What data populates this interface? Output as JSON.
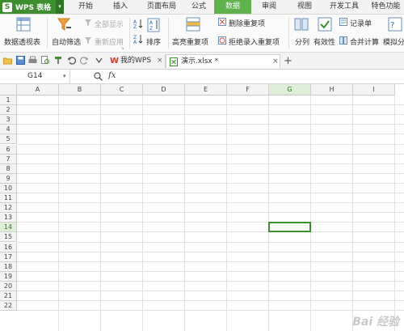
{
  "app": {
    "title": "WPS 表格",
    "logo": "S",
    "drop": "▾"
  },
  "menu": {
    "tabs": [
      "开始",
      "插入",
      "页面布局",
      "公式",
      "数据",
      "审阅",
      "视图",
      "开发工具",
      "特色功能"
    ],
    "active": "数据"
  },
  "ribbon": {
    "pivot": "数据透视表",
    "autofilter": "自动筛选",
    "showall": "全部显示",
    "reapply": "重新应用",
    "sort": "排序",
    "highlight_dup": "高亮重复项",
    "remove_dup": "删除重复项",
    "reject_dup": "拒绝录入重复项",
    "split": "分列",
    "validity": "有效性",
    "record": "记录单",
    "consolidate": "合并计算",
    "whatif": "模拟分"
  },
  "quick": {
    "docs": [
      {
        "label": "我的WPS"
      },
      {
        "label": "演示.xlsx *"
      }
    ],
    "add": "+"
  },
  "formula": {
    "cell_ref": "G14",
    "fx": "fx"
  },
  "grid": {
    "columns": [
      "A",
      "B",
      "C",
      "D",
      "E",
      "F",
      "G",
      "H",
      "I"
    ],
    "rows": [
      "1",
      "2",
      "3",
      "4",
      "5",
      "6",
      "7",
      "8",
      "9",
      "10",
      "11",
      "12",
      "13",
      "14",
      "15",
      "16",
      "17",
      "18",
      "19",
      "20",
      "21",
      "22"
    ],
    "active": {
      "col": "G",
      "row": "14"
    }
  },
  "watermark": "Bai 经验"
}
